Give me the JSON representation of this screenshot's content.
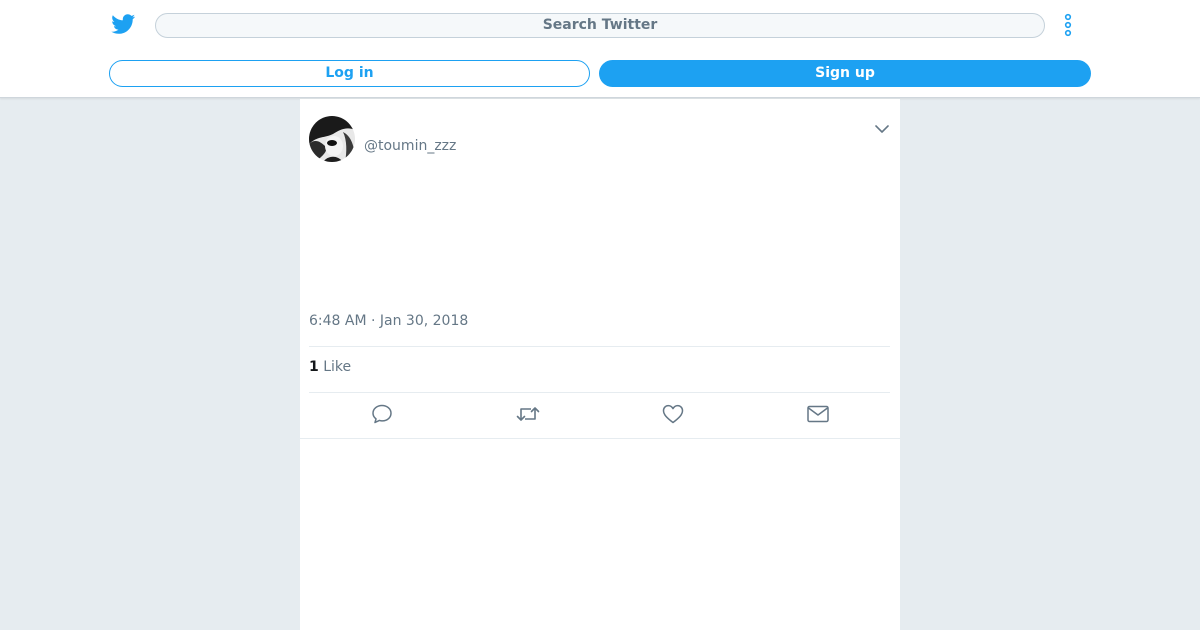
{
  "header": {
    "logo_icon": "twitter-bird-icon",
    "search_placeholder": "Search Twitter",
    "more_icon": "more-vertical-icon",
    "login_label": "Log in",
    "signup_label": "Sign up",
    "accent_color": "#1da1f2"
  },
  "tweet": {
    "handle": "@toumin_zzz",
    "timestamp": "6:48 AM · Jan 30, 2018",
    "likes_count": "1",
    "likes_label": "Like",
    "actions": [
      "reply-icon",
      "retweet-icon",
      "like-icon",
      "direct-message-icon"
    ]
  }
}
